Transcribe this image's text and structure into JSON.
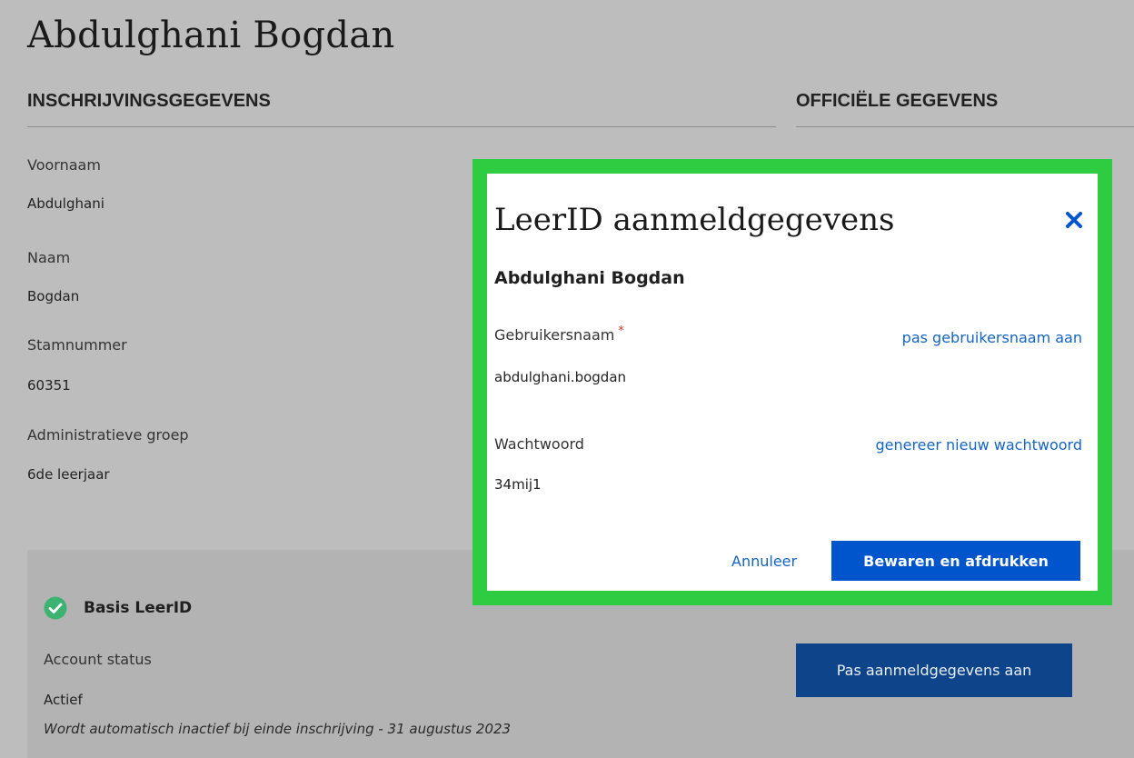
{
  "page": {
    "title": "Abdulghani Bogdan"
  },
  "sections": {
    "enrollment_heading": "INSCHRIJVINGSGEGEVENS",
    "official_heading": "OFFICIËLE GEGEVENS"
  },
  "fields": [
    {
      "label": "Voornaam",
      "value": "Abdulghani"
    },
    {
      "label": "Naam",
      "value": "Bogdan"
    },
    {
      "label": "Stamnummer",
      "value": "60351"
    },
    {
      "label": "Administratieve groep",
      "value": "6de leerjaar"
    }
  ],
  "basis": {
    "title": "Basis LeerID",
    "status_label": "Account status",
    "status_value": "Actief",
    "note": "Wordt automatisch inactief bij einde inschrijving - 31 augustus 2023",
    "edit_button": "Pas aanmeldgegevens aan",
    "check_color": "#3cb371"
  },
  "modal": {
    "title": "LeerID aanmeldgegevens",
    "student_name": "Abdulghani Bogdan",
    "username_label": "Gebruikersnaam",
    "required_mark": "*",
    "username_link": "pas gebruikersnaam aan",
    "username_value": "abdulghani.bogdan",
    "password_label": "Wachtwoord",
    "password_link": "genereer nieuw wachtwoord",
    "password_value": "34mij1",
    "cancel": "Annuleer",
    "save": "Bewaren en afdrukken",
    "highlight_color": "#2ecc40",
    "accent_color": "#0055cc"
  }
}
